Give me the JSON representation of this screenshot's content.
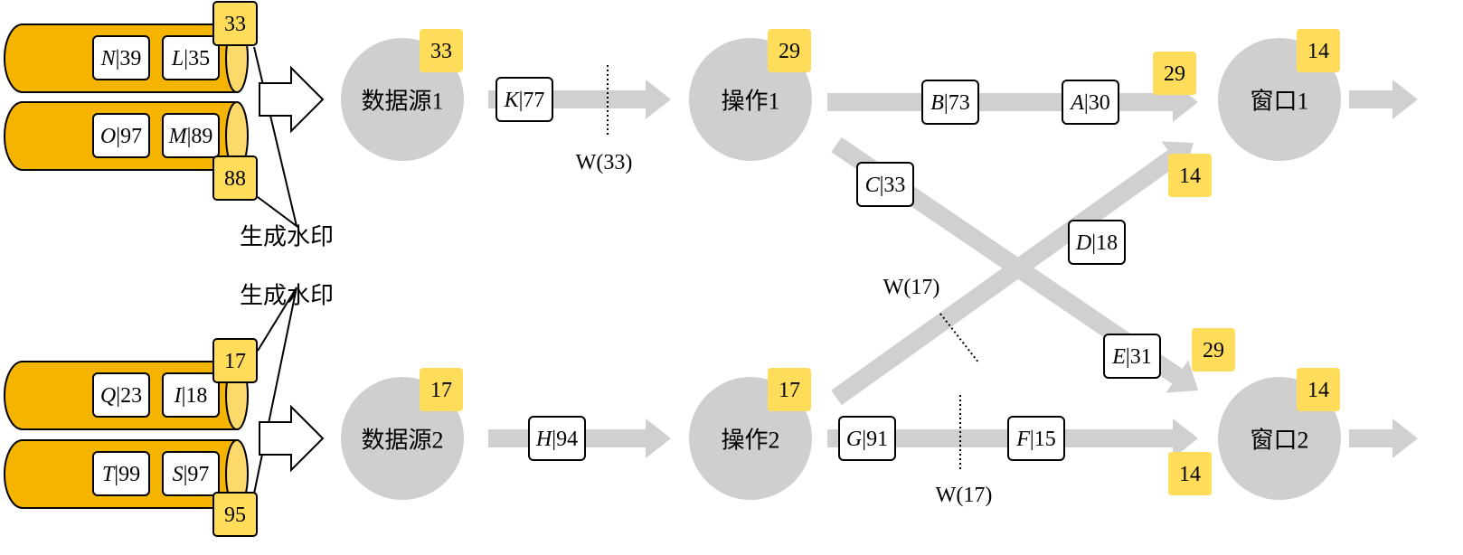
{
  "colors": {
    "cylinder": "#F5B400",
    "cylinder_end": "#FDD86A",
    "badge": "#FFDC5A",
    "node": "#CFCFCF",
    "flow": "#D0D0D0"
  },
  "sources": [
    {
      "partitions": [
        {
          "events": [
            {
              "key": "N",
              "val": "39"
            },
            {
              "key": "L",
              "val": "35"
            }
          ],
          "watermark": "33"
        },
        {
          "events": [
            {
              "key": "O",
              "val": "97"
            },
            {
              "key": "M",
              "val": "89"
            }
          ],
          "watermark": "88"
        }
      ],
      "generate_label": "生成水印"
    },
    {
      "partitions": [
        {
          "events": [
            {
              "key": "Q",
              "val": "23"
            },
            {
              "key": "I",
              "val": "18"
            }
          ],
          "watermark": "17"
        },
        {
          "events": [
            {
              "key": "T",
              "val": "99"
            },
            {
              "key": "S",
              "val": "97"
            }
          ],
          "watermark": "95"
        }
      ],
      "generate_label": "生成水印"
    }
  ],
  "nodes": [
    {
      "label": "数据源1",
      "watermark": "33"
    },
    {
      "label": "操作1",
      "watermark": "29"
    },
    {
      "label": "窗口1",
      "watermark": "14"
    },
    {
      "label": "数据源2",
      "watermark": "17"
    },
    {
      "label": "操作2",
      "watermark": "17"
    },
    {
      "label": "窗口2",
      "watermark": "14"
    }
  ],
  "edges": [
    {
      "from": "数据源1",
      "to": "操作1",
      "events": [
        {
          "key": "K",
          "val": "77"
        }
      ],
      "watermark_marker": "W(33)"
    },
    {
      "from": "操作1",
      "to": "窗口1",
      "events": [
        {
          "key": "B",
          "val": "73"
        },
        {
          "key": "A",
          "val": "30"
        }
      ],
      "arrival_watermark": "29"
    },
    {
      "from": "操作1",
      "to": "窗口2",
      "events": [
        {
          "key": "C",
          "val": "33"
        },
        {
          "key": "E",
          "val": "31"
        }
      ],
      "arrival_watermark": "29"
    },
    {
      "from": "操作2",
      "to": "窗口1",
      "events": [
        {
          "key": "D",
          "val": "18"
        }
      ],
      "watermark_marker": "W(17)",
      "arrival_watermark": "14"
    },
    {
      "from": "数据源2",
      "to": "操作2",
      "events": [
        {
          "key": "H",
          "val": "94"
        }
      ]
    },
    {
      "from": "操作2",
      "to": "窗口2",
      "events": [
        {
          "key": "G",
          "val": "91"
        },
        {
          "key": "F",
          "val": "15"
        }
      ],
      "watermark_marker": "W(17)",
      "arrival_watermark": "14"
    }
  ]
}
